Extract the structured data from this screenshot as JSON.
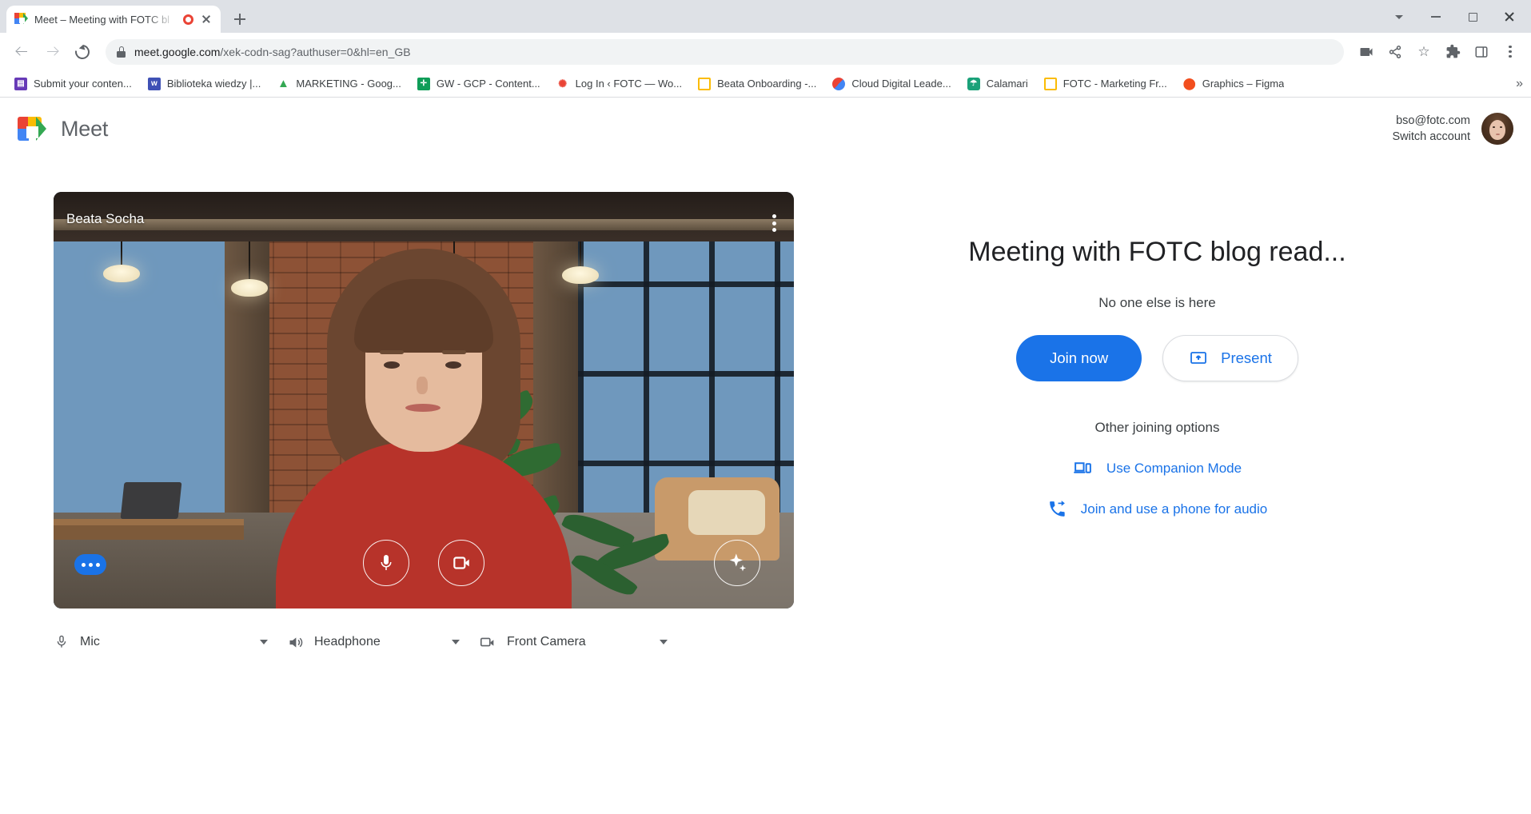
{
  "browser": {
    "tab": {
      "title": "Meet – Meeting with FOTC bl",
      "favicon": "google-meet-icon",
      "recording_indicator": "recording-dot"
    },
    "new_tab_label": "+",
    "window_controls": {
      "search_tabs": "chevron-down-icon",
      "minimize": "minimize-icon",
      "maximize": "maximize-icon",
      "close": "close-icon"
    },
    "omnibox": {
      "url_domain": "meet.google.com",
      "url_path": "/xek-codn-sag?authuser=0&hl=en_GB",
      "lock": "lock-icon"
    },
    "toolbar_icons": [
      "video-camera-icon",
      "share-icon",
      "bookmark-star-icon",
      "extensions-puzzle-icon",
      "side-panel-icon",
      "chrome-menu-icon"
    ],
    "bookmarks": [
      {
        "label": "Submit your conten...",
        "icon_color": "#673ab7",
        "glyph": "▤"
      },
      {
        "label": "Biblioteka wiedzy |...",
        "icon_color": "#3f51b5",
        "glyph": "w"
      },
      {
        "label": "MARKETING - Goog...",
        "icon_color": "#34a853",
        "glyph": "▲"
      },
      {
        "label": "GW - GCP - Content...",
        "icon_color": "#0f9d58",
        "glyph": "✛"
      },
      {
        "label": "Log In ‹ FOTC — Wo...",
        "icon_color": "#ea4335",
        "glyph": "✺"
      },
      {
        "label": "Beata Onboarding -...",
        "icon_color": "#fbbc04",
        "glyph": "▭"
      },
      {
        "label": "Cloud Digital Leade...",
        "icon_color": "#4285f4",
        "glyph": "◐"
      },
      {
        "label": "Calamari",
        "icon_color": "#1aa179",
        "glyph": "☂"
      },
      {
        "label": "FOTC - Marketing Fr...",
        "icon_color": "#fbbc04",
        "glyph": "▭"
      },
      {
        "label": "Graphics – Figma",
        "icon_color": "#f24e1e",
        "glyph": "⬤"
      }
    ],
    "bookmarks_overflow": "»"
  },
  "meet": {
    "brand": {
      "name": "Meet",
      "logo": "google-meet-logo"
    },
    "account": {
      "email": "bso@fotc.com",
      "switch_label": "Switch account",
      "avatar": "user-avatar"
    },
    "preview": {
      "participant_name": "Beata Socha",
      "more_options": "more-vertical-icon",
      "mic_button": "microphone-icon",
      "camera_button": "video-camera-icon",
      "effects_button": "visual-effects-icon",
      "captions_badge": "more-options-badge"
    },
    "devices": [
      {
        "label": "Mic",
        "icon": "microphone-icon"
      },
      {
        "label": "Headphone",
        "icon": "speaker-icon"
      },
      {
        "label": "Front Camera",
        "icon": "video-camera-icon"
      }
    ],
    "join_panel": {
      "title": "Meeting with FOTC blog read...",
      "status": "No one else is here",
      "join_label": "Join now",
      "present_label": "Present",
      "present_icon": "present-screen-icon",
      "other_options_label": "Other joining options",
      "links": [
        {
          "label": "Use Companion Mode",
          "icon": "companion-devices-icon"
        },
        {
          "label": "Join and use a phone for audio",
          "icon": "phone-forward-icon"
        }
      ]
    },
    "colors": {
      "accent": "#1a73e8",
      "text": "#3c4043",
      "title": "#202124"
    }
  }
}
